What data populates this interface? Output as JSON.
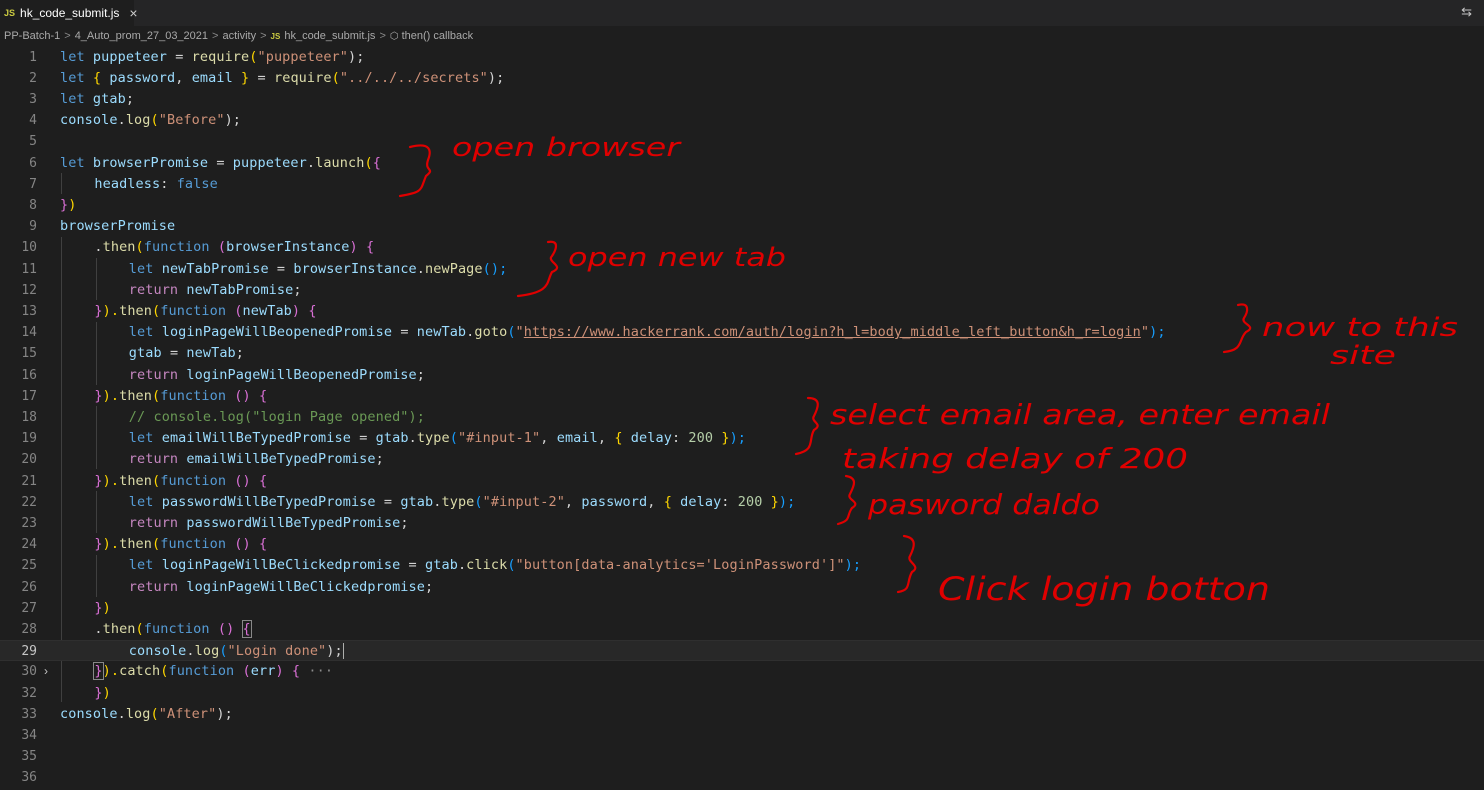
{
  "tab": {
    "badge": "JS",
    "filename": "hk_code_submit.js",
    "close": "×"
  },
  "toolbar": {
    "split": "⇆"
  },
  "breadcrumbs": {
    "items": [
      "PP-Batch-1",
      "4_Auto_prom_27_03_2021",
      "activity"
    ],
    "file_badge": "JS",
    "file": "hk_code_submit.js",
    "symbol": "then() callback",
    "sep": ">"
  },
  "editor": {
    "line_numbers": [
      "1",
      "2",
      "3",
      "4",
      "5",
      "6",
      "7",
      "8",
      "9",
      "10",
      "11",
      "12",
      "13",
      "14",
      "15",
      "16",
      "17",
      "18",
      "19",
      "20",
      "21",
      "22",
      "23",
      "24",
      "25",
      "26",
      "27",
      "28",
      "29",
      "30",
      "32",
      "33",
      "34",
      "35",
      "36"
    ],
    "active_line": "29",
    "folded_line": "30",
    "fold_icon": "›",
    "code": {
      "l1": [
        "let ",
        "puppeteer",
        " = ",
        "require",
        "(",
        "\"puppeteer\"",
        ");"
      ],
      "l2": [
        "let ",
        "{ ",
        "password",
        ", ",
        "email",
        " }",
        " = ",
        "require",
        "(",
        "\"../../../secrets\"",
        ");"
      ],
      "l3": [
        "let ",
        "gtab",
        ";"
      ],
      "l4": [
        "console",
        ".",
        "log",
        "(",
        "\"Before\"",
        ");"
      ],
      "l6": [
        "let ",
        "browserPromise",
        " = ",
        "puppeteer",
        ".",
        "launch",
        "(",
        "{"
      ],
      "l7": [
        "headless",
        ": ",
        "false"
      ],
      "l8": [
        "}",
        ")"
      ],
      "l9": [
        "browserPromise"
      ],
      "l10": [
        ".",
        "then",
        "(",
        "function",
        " (",
        "browserInstance",
        ") ",
        "{"
      ],
      "l11": [
        "let ",
        "newTabPromise",
        " = ",
        "browserInstance",
        ".",
        "newPage",
        "();"
      ],
      "l12": [
        "return ",
        "newTabPromise",
        ";"
      ],
      "l13": [
        "}",
        ").",
        "then",
        "(",
        "function",
        " (",
        "newTab",
        ") ",
        "{"
      ],
      "l14": [
        "let ",
        "loginPageWillBeopenedPromise",
        " = ",
        "newTab",
        ".",
        "goto",
        "(",
        "\"",
        "https://www.hackerrank.com/auth/login?h_l=body_middle_left_button&h_r=login",
        "\"",
        ");"
      ],
      "l15": [
        "gtab",
        " = ",
        "newTab",
        ";"
      ],
      "l16": [
        "return ",
        "loginPageWillBeopenedPromise",
        ";"
      ],
      "l17": [
        "}",
        ").",
        "then",
        "(",
        "function",
        " () ",
        "{"
      ],
      "l18": [
        "// console.log(\"login Page opened\");"
      ],
      "l19": [
        "let ",
        "emailWillBeTypedPromise",
        " = ",
        "gtab",
        ".",
        "type",
        "(",
        "\"#input-1\"",
        ", ",
        "email",
        ", ",
        "{ ",
        "delay",
        ": ",
        "200",
        " }",
        ");"
      ],
      "l20": [
        "return ",
        "emailWillBeTypedPromise",
        ";"
      ],
      "l21": [
        "}",
        ").",
        "then",
        "(",
        "function",
        " () ",
        "{"
      ],
      "l22": [
        "let ",
        "passwordWillBeTypedPromise",
        " = ",
        "gtab",
        ".",
        "type",
        "(",
        "\"#input-2\"",
        ", ",
        "password",
        ", ",
        "{ ",
        "delay",
        ": ",
        "200",
        " }",
        ");"
      ],
      "l23": [
        "return ",
        "passwordWillBeTypedPromise",
        ";"
      ],
      "l24": [
        "}",
        ").",
        "then",
        "(",
        "function",
        " () ",
        "{"
      ],
      "l25": [
        "let ",
        "loginPageWillBeClickedpromise",
        " = ",
        "gtab",
        ".",
        "click",
        "(",
        "\"button[data-analytics='LoginPassword']\"",
        ");"
      ],
      "l26": [
        "return ",
        "loginPageWillBeClickedpromise",
        ";"
      ],
      "l27": [
        "}",
        ")"
      ],
      "l28": [
        ".",
        "then",
        "(",
        "function",
        " () ",
        "{"
      ],
      "l29": [
        "console",
        ".",
        "log",
        "(",
        "\"Login done\"",
        ");"
      ],
      "l30": [
        "}",
        ").",
        "catch",
        "(",
        "function",
        " (",
        "err",
        ") ",
        "{",
        " ···"
      ],
      "l32": [
        "}",
        ")"
      ],
      "l33": [
        "console",
        ".",
        "log",
        "(",
        "\"After\"",
        ");"
      ]
    }
  },
  "annotations": {
    "a1": "open browser",
    "a2": "open new tab",
    "a3a": "now to this",
    "a3b": "site",
    "a4a": "select email area, enter email",
    "a4b": "taking delay of 200",
    "a5": "pasword daldo",
    "a6": "Click login botton"
  }
}
